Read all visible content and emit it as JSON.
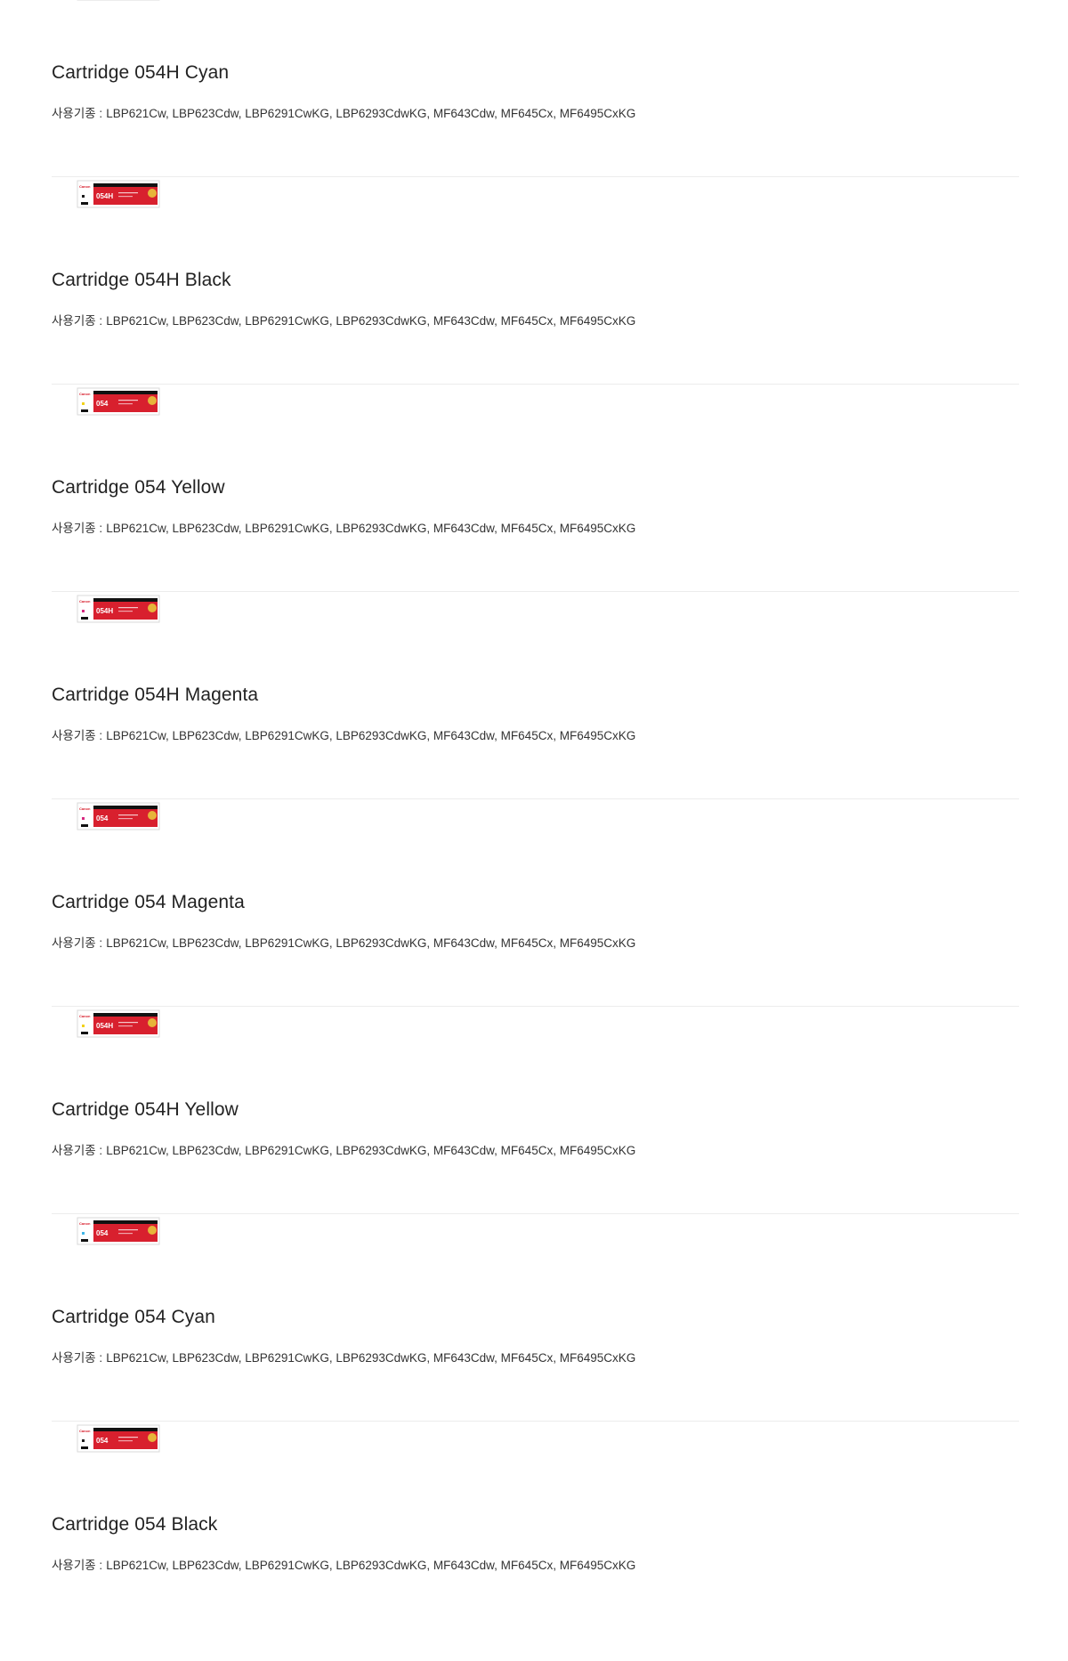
{
  "products": [
    {
      "name": "Cartridge 054H Cyan",
      "box_label": "054H",
      "color_swatch": "#3fb6e8",
      "compat_label": "사용기종 :",
      "compat_models": "LBP621Cw, LBP623Cdw, LBP6291CwKG, LBP6293CdwKG, MF643Cdw, MF645Cx, MF6495CxKG"
    },
    {
      "name": "Cartridge 054H Black",
      "box_label": "054H",
      "color_swatch": "#1a1a1a",
      "compat_label": "사용기종 :",
      "compat_models": "LBP621Cw, LBP623Cdw, LBP6291CwKG, LBP6293CdwKG, MF643Cdw, MF645Cx, MF6495CxKG"
    },
    {
      "name": "Cartridge 054 Yellow",
      "box_label": "054",
      "color_swatch": "#f2d21a",
      "compat_label": "사용기종 :",
      "compat_models": "LBP621Cw, LBP623Cdw, LBP6291CwKG, LBP6293CdwKG, MF643Cdw, MF645Cx, MF6495CxKG"
    },
    {
      "name": "Cartridge 054H Magenta",
      "box_label": "054H",
      "color_swatch": "#d6287f",
      "compat_label": "사용기종 :",
      "compat_models": "LBP621Cw, LBP623Cdw, LBP6291CwKG, LBP6293CdwKG, MF643Cdw, MF645Cx, MF6495CxKG"
    },
    {
      "name": "Cartridge 054 Magenta",
      "box_label": "054",
      "color_swatch": "#d6287f",
      "compat_label": "사용기종 :",
      "compat_models": "LBP621Cw, LBP623Cdw, LBP6291CwKG, LBP6293CdwKG, MF643Cdw, MF645Cx, MF6495CxKG"
    },
    {
      "name": "Cartridge 054H Yellow",
      "box_label": "054H",
      "color_swatch": "#f2d21a",
      "compat_label": "사용기종 :",
      "compat_models": "LBP621Cw, LBP623Cdw, LBP6291CwKG, LBP6293CdwKG, MF643Cdw, MF645Cx, MF6495CxKG"
    },
    {
      "name": "Cartridge 054 Cyan",
      "box_label": "054",
      "color_swatch": "#3fb6e8",
      "compat_label": "사용기종 :",
      "compat_models": "LBP621Cw, LBP623Cdw, LBP6291CwKG, LBP6293CdwKG, MF643Cdw, MF645Cx, MF6495CxKG"
    },
    {
      "name": "Cartridge 054 Black",
      "box_label": "054",
      "color_swatch": "#1a1a1a",
      "compat_label": "사용기종 :",
      "compat_models": "LBP621Cw, LBP623Cdw, LBP6291CwKG, LBP6293CdwKG, MF643Cdw, MF645Cx, MF6495CxKG"
    }
  ],
  "colors": {
    "box_red": "#d8202e",
    "box_dark": "#111111",
    "badge_gold": "#e7b43a",
    "brand_text": "#d8202e"
  }
}
